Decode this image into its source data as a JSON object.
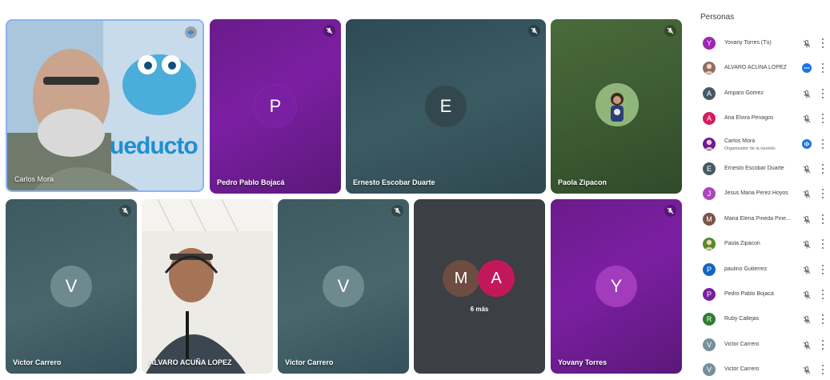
{
  "tiles": [
    {
      "name": "Carlos Mora",
      "type": "video",
      "speaking": true,
      "logo_text": "ueducto"
    },
    {
      "name": "Pedro Pablo Bojacá",
      "type": "letter",
      "letter": "P",
      "muted": true
    },
    {
      "name": "Ernesto Escobar Duarte",
      "type": "letter",
      "letter": "E",
      "muted": true
    },
    {
      "name": "Paola Zipacon",
      "type": "photo",
      "muted": true
    },
    {
      "name": "Victor Carrero",
      "type": "letter",
      "letter": "V",
      "muted": true
    },
    {
      "name": "ALVARO ACUÑA LOPEZ",
      "type": "video"
    },
    {
      "name": "Victor Carrero",
      "type": "letter",
      "letter": "V",
      "muted": true
    },
    {
      "type": "overflow",
      "letters": [
        "M",
        "A"
      ],
      "label": "6 más"
    },
    {
      "name": "Yovany Torres",
      "type": "letter",
      "letter": "Y",
      "muted": true
    }
  ],
  "panel": {
    "title": "Personas",
    "people": [
      {
        "name": "Yovany Torres (Tú)",
        "initial": "Y",
        "color": "#9c27b0",
        "status": "muted"
      },
      {
        "name": "ALVARO ACUÑA LOPEZ",
        "initial": "",
        "color": "#8d6e63",
        "status": "more"
      },
      {
        "name": "Amparo Gómez",
        "initial": "A",
        "color": "#455a64",
        "status": "muted"
      },
      {
        "name": "Ana Elvira Penagos",
        "initial": "A",
        "color": "#d81b60",
        "status": "muted"
      },
      {
        "name": "Carlos Mora",
        "subtitle": "Organizador de la reunión",
        "initial": "",
        "color": "#6a1b9a",
        "status": "speaking"
      },
      {
        "name": "Ernesto Escobar Duarte",
        "initial": "E",
        "color": "#455a64",
        "status": "muted"
      },
      {
        "name": "Jesus Maria Perez Hoyos",
        "initial": "J",
        "color": "#ab47bc",
        "status": "muted"
      },
      {
        "name": "Maria Elena Pineda Pine...",
        "initial": "M",
        "color": "#795548",
        "status": "muted"
      },
      {
        "name": "Paola Zipacon",
        "initial": "",
        "color": "#558b2f",
        "status": "muted"
      },
      {
        "name": "paulino Gutierrez",
        "initial": "P",
        "color": "#1565c0",
        "status": "muted"
      },
      {
        "name": "Pedro Pablo Bojacá",
        "initial": "P",
        "color": "#7b1fa2",
        "status": "muted"
      },
      {
        "name": "Ruby Callejas",
        "initial": "R",
        "color": "#2e7d32",
        "status": "muted"
      },
      {
        "name": "Victor Carrero",
        "initial": "V",
        "color": "#78909c",
        "status": "muted"
      },
      {
        "name": "Victor Carrero",
        "initial": "V",
        "color": "#78909c",
        "status": "muted"
      }
    ]
  },
  "colors": {
    "speaking_border": "#8ab4f8",
    "accent": "#1a73e8"
  }
}
